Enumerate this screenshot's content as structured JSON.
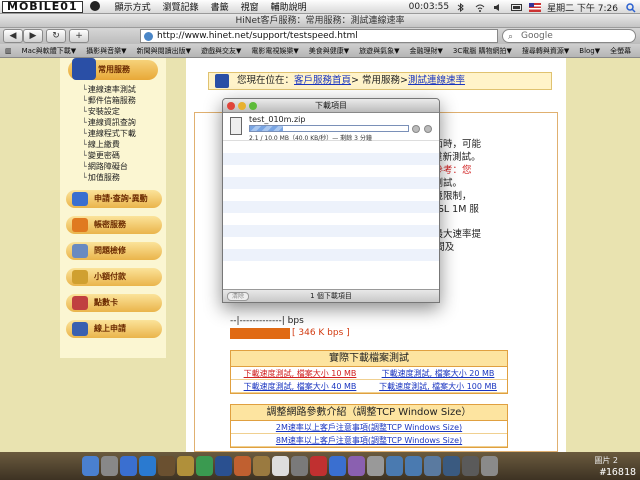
{
  "menubar": {
    "logo": "MOBILE01",
    "items": [
      "顯示方式",
      "瀏覽記錄",
      "書籤",
      "視窗",
      "輔助說明"
    ],
    "timer": "00:03:55",
    "clock": "星期二 下午 7:26"
  },
  "window": {
    "title": "HiNet客戶服務：常用服務：測試連線速率"
  },
  "toolbar": {
    "url": "http://www.hinet.net/support/testspeed.html",
    "search_placeholder": "Google"
  },
  "bookmarks": [
    "Mac與軟體下載▼",
    "攝影與音樂▼",
    "新聞與閱讀出版▼",
    "遊戲與交友▼",
    "電影電視娛樂▼",
    "美食與健康▼",
    "旅遊與氣象▼",
    "金融理財▼",
    "3C電腦 購物網拍▼",
    "搜尋轉與資源▼",
    "Blog▼",
    "全螢幕"
  ],
  "sidebar": {
    "header": "常用服務",
    "links": [
      "連線速率測試",
      "郵件信箱服務",
      "安裝設定",
      "連線資訊查詢",
      "連線程式下載",
      "線上繳費",
      "變更密碼",
      "網路障礙台",
      "加值服務"
    ],
    "nav": [
      "申請‧查詢‧異動",
      "帳密服務",
      "問題檢修",
      "小額付款",
      "點數卡",
      "線上申請"
    ]
  },
  "content": {
    "location_prefix": "您現在位在：",
    "location_link1": "客戶服務首頁",
    "location_mid": "> 常用服務>",
    "location_link2": "測試連線速率",
    "snips": [
      "頁面時，可能",
      "5 重新測試。",
      "供參考：您",
      "輸測試。",
      "環境限制，",
      "ADSL 1M 服",
      "之最大速率提",
      "M 間及",
      "5M"
    ],
    "bps_label": "--|-------------| bps",
    "bar_label": "[ 346 K bps ]",
    "dl_title": "實際下載檔案測試",
    "dl_links": [
      [
        "下載速度測試, 檔案大小 10 MB",
        "下載速度測試, 檔案大小 20 MB"
      ],
      [
        "下載速度測試, 檔案大小 40 MB",
        "下載速度測試, 檔案大小 100 MB"
      ]
    ],
    "tune_title": "調整網路參數介紹（調整TCP Window Size）",
    "tune_links": [
      "2M速率以上客戶注意事項(調整TCP Windows Size)",
      "8M速率以上客戶注意事項(調整TCP Windows Size)"
    ]
  },
  "downloads": {
    "title": "下載項目",
    "filename": "test_010m.zip",
    "progress": 0.21,
    "status": "2.1 / 10.0 MB（40.0 KB/秒）— 剩餘 3 分鐘",
    "clear": "清除",
    "count": "1 個下載項目"
  },
  "dock": {
    "right_label": "圖片 2"
  },
  "watermark": "#16818",
  "colors": {
    "accent": "#e8a837",
    "link": "#1a35c0",
    "bar": "#e06a14"
  }
}
